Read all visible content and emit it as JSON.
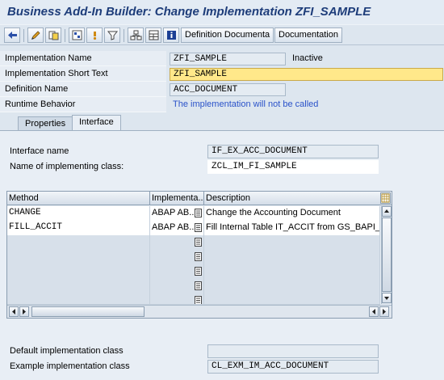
{
  "window": {
    "title": "Business Add-In Builder: Change Implementation ZFI_SAMPLE"
  },
  "toolbar": {
    "icons": [
      "back-icon",
      "edit-toggle-icon",
      "other-object-icon",
      "check-icon",
      "activate-icon",
      "where-used-icon",
      "hierarchy-icon",
      "layout-icon",
      "info-icon"
    ],
    "definition_documentation": "Definition Documenta",
    "documentation": "Documentation"
  },
  "form": {
    "impl_name_label": "Implementation Name",
    "impl_name_value": "ZFI_SAMPLE",
    "status": "Inactive",
    "short_text_label": "Implementation Short Text",
    "short_text_value": "ZFI_SAMPLE",
    "def_name_label": "Definition Name",
    "def_name_value": "ACC_DOCUMENT",
    "runtime_label": "Runtime Behavior",
    "runtime_value": "The implementation will not be called"
  },
  "tabs": {
    "properties": "Properties",
    "interface": "Interface",
    "active": "interface"
  },
  "interface": {
    "name_label": "Interface name",
    "name_value": "IF_EX_ACC_DOCUMENT",
    "class_label": "Name of implementing class:",
    "class_value": "ZCL_IM_FI_SAMPLE"
  },
  "methods": {
    "headers": {
      "method": "Method",
      "implementation": "Implementa...",
      "description": "Description"
    },
    "rows": [
      {
        "method": "CHANGE",
        "implementation": "ABAP AB...",
        "description": "Change the Accounting Document"
      },
      {
        "method": "FILL_ACCIT",
        "implementation": "ABAP AB...",
        "description": "Fill Internal Table IT_ACCIT from GS_BAPI_AC"
      },
      {
        "method": "",
        "implementation": "",
        "description": ""
      },
      {
        "method": "",
        "implementation": "",
        "description": ""
      },
      {
        "method": "",
        "implementation": "",
        "description": ""
      },
      {
        "method": "",
        "implementation": "",
        "description": ""
      },
      {
        "method": "",
        "implementation": "",
        "description": ""
      }
    ]
  },
  "footer": {
    "default_label": "Default implementation class",
    "default_value": "",
    "example_label": "Example implementation class",
    "example_value": "CL_EXM_IM_ACC_DOCUMENT"
  }
}
